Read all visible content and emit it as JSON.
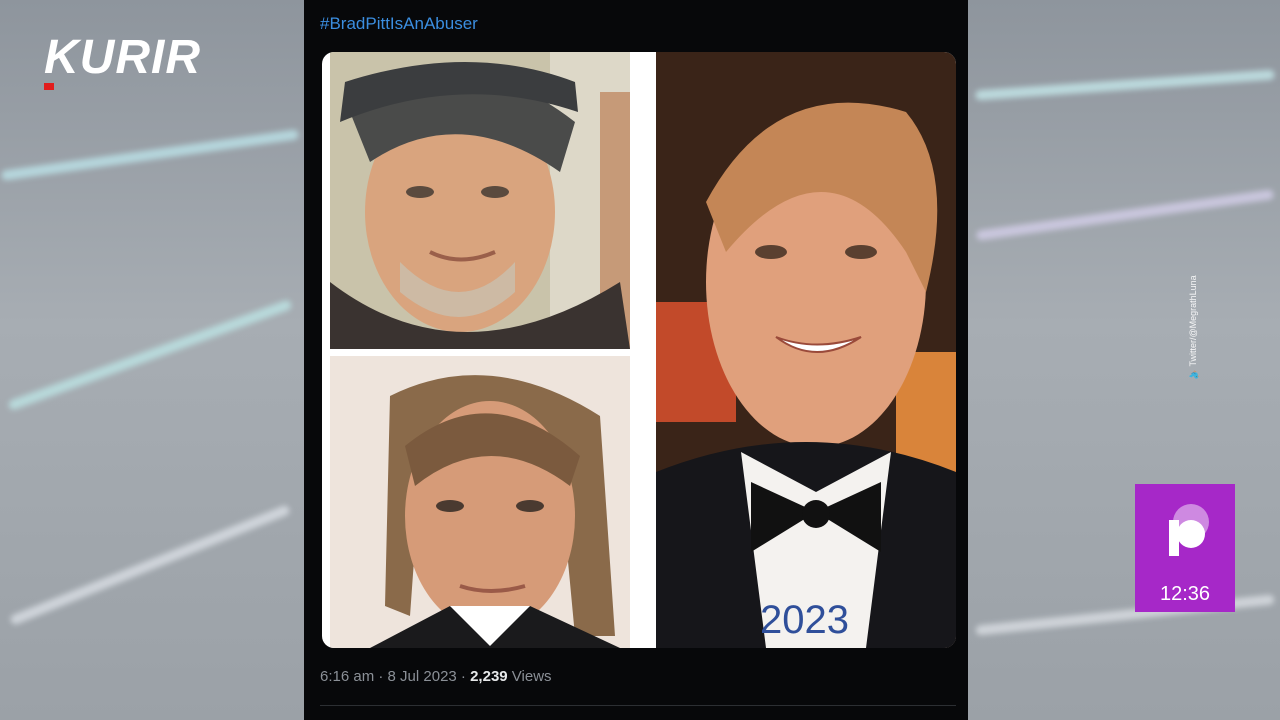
{
  "broadcast": {
    "logo_text": "KURIR",
    "clock": "12:36",
    "watermark": "Twitter/@MegrathLuna"
  },
  "tweet": {
    "hashtag": "#BradPittIsAnAbuser",
    "timestamp": "6:16 am · 8 Jul 2023 · ",
    "views_count": "2,239",
    "views_label": " Views",
    "image_caption_year": "2023"
  },
  "colors": {
    "hashtag": "#3b8ee0",
    "logo_accent": "#e21d1d",
    "clock_bg": "#a628c8"
  }
}
